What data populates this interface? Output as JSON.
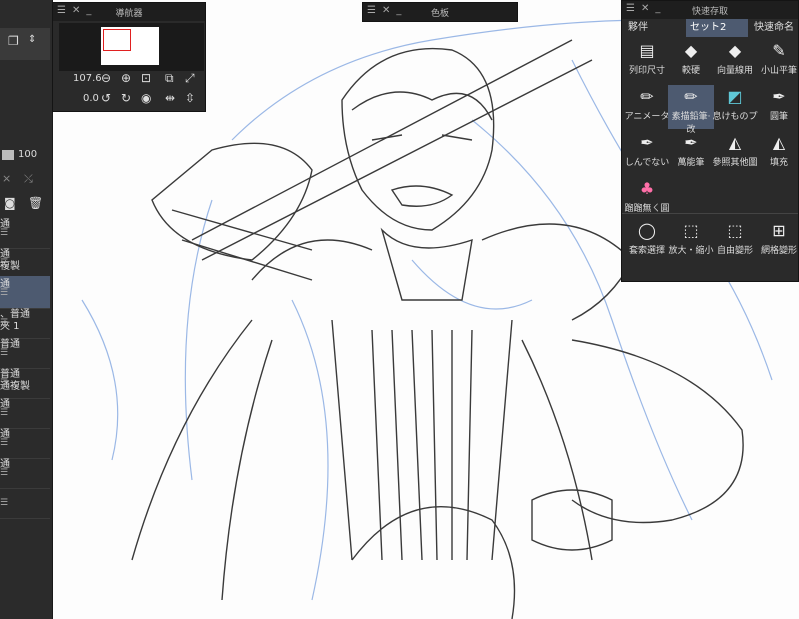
{
  "navigator": {
    "title": "導航器",
    "zoom": "107.6",
    "rotation": "0.0"
  },
  "color_panel": {
    "title": "色板"
  },
  "quick_access": {
    "title": "快速存取",
    "tabs": [
      "夥伴",
      "セット2",
      "快速命名"
    ],
    "tools": [
      {
        "label": "列印尺寸",
        "icon": "print-icon"
      },
      {
        "label": "較硬",
        "icon": "eraser-icon"
      },
      {
        "label": "向量線用",
        "icon": "vector-eraser-icon"
      },
      {
        "label": "小山平筆",
        "icon": "flat-brush-icon"
      },
      {
        "label": "アニメータ",
        "icon": "pencil-icon"
      },
      {
        "label": "素描鉛筆·改",
        "icon": "sketch-pencil-icon"
      },
      {
        "label": "息けものプ",
        "icon": "custom-brush-icon"
      },
      {
        "label": "圓筆",
        "icon": "round-pen-icon"
      },
      {
        "label": "しんでない",
        "icon": "pen-icon"
      },
      {
        "label": "萬能筆",
        "icon": "universal-pen-icon"
      },
      {
        "label": "參照其他圖",
        "icon": "fill-reference-icon"
      },
      {
        "label": "填充",
        "icon": "fill-bucket-icon"
      },
      {
        "label": "蹓蹓無ㄑ圓",
        "icon": "cake-icon"
      }
    ],
    "bottom_tools": [
      {
        "label": "套索選擇",
        "icon": "lasso-icon"
      },
      {
        "label": "放大・縮小",
        "icon": "scale-icon"
      },
      {
        "label": "自由變形",
        "icon": "free-transform-icon"
      },
      {
        "label": "網格變形",
        "icon": "mesh-transform-icon"
      }
    ]
  },
  "layers": {
    "opacity": "100",
    "rows": [
      {
        "label": "通"
      },
      {
        "label": "通\n複製"
      },
      {
        "label": "通"
      },
      {
        "label": "、普通\n夾 1"
      },
      {
        "label": "普通"
      },
      {
        "label": "普通\n通複製"
      },
      {
        "label": "通"
      },
      {
        "label": "通"
      },
      {
        "label": "通"
      },
      {
        "label": ""
      }
    ]
  }
}
